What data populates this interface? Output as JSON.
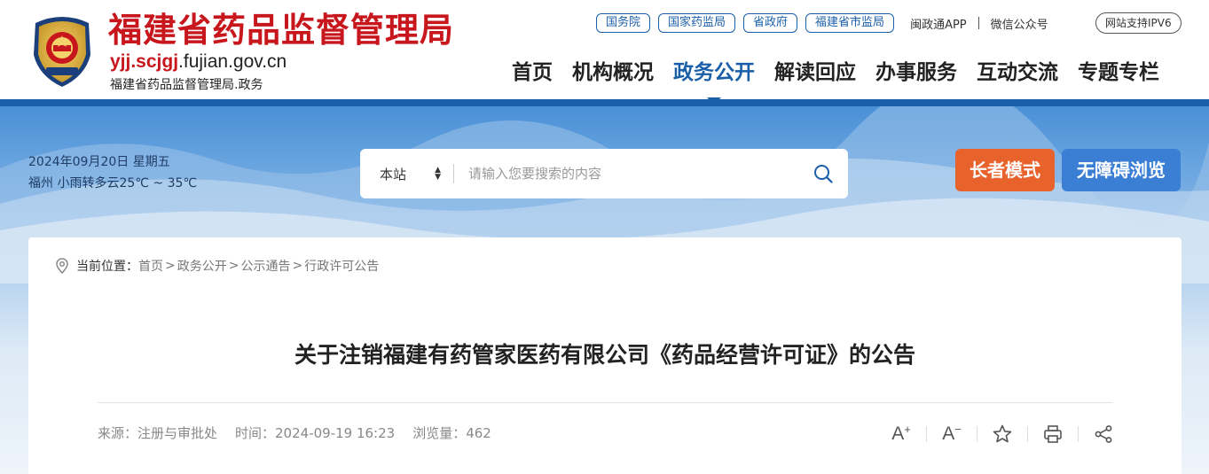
{
  "header": {
    "title": "福建省药品监督管理局",
    "domain_highlight": "yjj.scjgj",
    "domain_rest": ".fujian.gov.cn",
    "subtitle": "福建省药品监督管理局.政务",
    "top_links": [
      "国务院",
      "国家药监局",
      "省政府",
      "福建省市监局"
    ],
    "app_link": "闽政通APP",
    "wechat_link": "微信公众号",
    "ipv6_label": "网站支持IPV6",
    "nav": [
      "首页",
      "机构概况",
      "政务公开",
      "解读回应",
      "办事服务",
      "互动交流",
      "专题专栏"
    ],
    "active_nav": "政务公开"
  },
  "banner": {
    "date": "2024年09月20日 星期五",
    "weather": "福州 小雨转多云25℃ ~ 35℃",
    "search_scope": "本站",
    "search_placeholder": "请输入您要搜索的内容",
    "elder_mode": "长者模式",
    "accessible": "无障碍浏览"
  },
  "breadcrumb": {
    "label": "当前位置：",
    "items": [
      "首页",
      "政务公开",
      "公示通告",
      "行政许可公告"
    ],
    "separator": ">"
  },
  "article": {
    "title": "关于注销福建有药管家医药有限公司《药品经营许可证》的公告",
    "source": "来源：注册与审批处",
    "time": "时间：2024-09-19 16:23",
    "views": "浏览量：462"
  },
  "colors": {
    "brand_red": "#c8161d",
    "brand_blue": "#1b5fa8",
    "elder_orange": "#e8622c",
    "access_blue": "#3b7fd4"
  },
  "icons": [
    "national-emblem-icon",
    "search-icon",
    "location-pin-icon",
    "font-increase-icon",
    "font-decrease-icon",
    "star-icon",
    "print-icon",
    "share-icon"
  ]
}
